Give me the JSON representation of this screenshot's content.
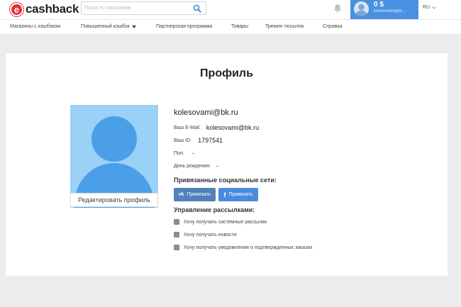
{
  "header": {
    "logo_letter": "e",
    "logo_text": "cashback",
    "search_placeholder": "Поиск по магазинам",
    "balance": "0 $",
    "account_email": "kolesovami@b...",
    "language": "RU"
  },
  "nav": {
    "items": [
      "Магазины с кэшбэком",
      "Повышенный кэшбэк",
      "Партнерская программа",
      "Товары",
      "Трекинг посылок",
      "Справка"
    ]
  },
  "profile": {
    "title": "Профиль",
    "edit_button": "Редактировать профиль",
    "email": "kolesovami@bk.ru",
    "fields": {
      "email_label": "Ваш E-Mail:",
      "email_value": "kolesovami@bk.ru",
      "id_label": "Ваш ID:",
      "id_value": "1797541",
      "gender_label": "Пол:",
      "gender_value": "-",
      "birthday_label": "День рождения:",
      "birthday_value": "-"
    },
    "social": {
      "heading": "Привязанные социальные сети:",
      "vk_label": "Привязать",
      "fb_label": "Привязать"
    },
    "mailing": {
      "heading": "Управление рассылками:",
      "options": [
        "Хочу получать системные рассылки",
        "Хочу получать новости",
        "Хочу получать уведомления о подтвержденных заказах"
      ]
    }
  },
  "colors": {
    "brand_red": "#e52e3c",
    "account_blue": "#4a90e2",
    "vk_blue": "#5181b8",
    "fb_blue": "#4a8be0",
    "avatar_bg": "#9bd0f7",
    "avatar_fg": "#4a9fe8"
  }
}
